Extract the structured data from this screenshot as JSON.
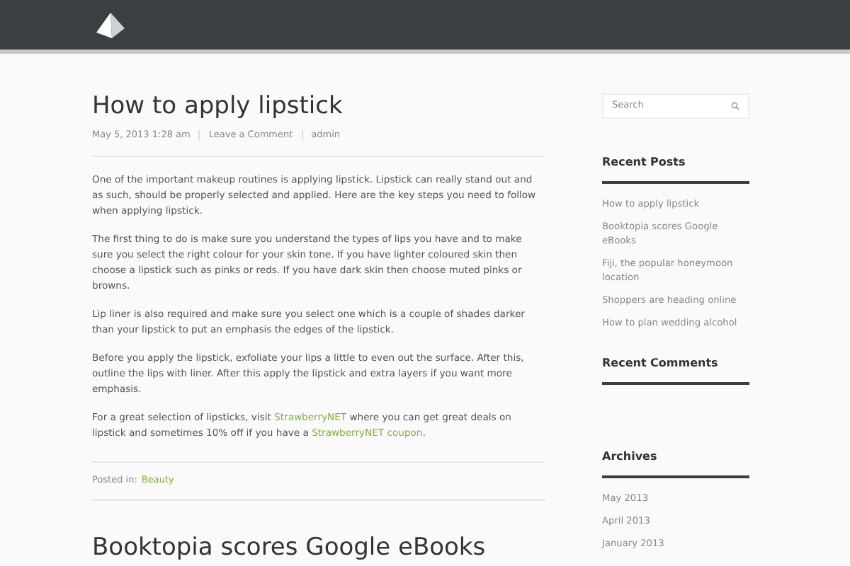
{
  "post": {
    "title": "How to apply lipstick",
    "meta": [
      "May 5, 2013 1:28 am",
      "Leave a Comment",
      "admin"
    ],
    "paragraphs": [
      [
        {
          "kind": "text",
          "text": "One of the important makeup routines is applying lipstick. Lipstick can really stand out and as such, should be properly selected and applied. Here are the key steps you need to follow when applying lipstick."
        }
      ],
      [
        {
          "kind": "text",
          "text": "The first thing to do is make sure you understand the types of lips you have and to make sure you select the right colour for your skin tone.  If you have lighter coloured skin then choose a lipstick such as pinks or reds. If you have dark skin then choose muted pinks or browns."
        }
      ],
      [
        {
          "kind": "text",
          "text": "Lip liner is also required and make sure you select one which is a couple of shades darker than your lipstick to put an emphasis the edges of the lipstick."
        }
      ],
      [
        {
          "kind": "text",
          "text": "Before you apply the lipstick, exfoliate your lips a little to even out the surface. After this, outline the lips with liner. After this apply the lipstick and extra layers if you want more emphasis."
        }
      ],
      [
        {
          "kind": "text",
          "text": "For a great selection of lipsticks, visit "
        },
        {
          "kind": "link",
          "text": "StrawberryNET"
        },
        {
          "kind": "text",
          "text": " where you can get great deals on lipstick and sometimes 10% off if you have a "
        },
        {
          "kind": "link",
          "text": "StrawberryNET coupon"
        },
        {
          "kind": "text",
          "text": "."
        }
      ]
    ],
    "posted_in_label": "Posted in:",
    "category": "Beauty"
  },
  "next_post": {
    "title": "Booktopia scores Google eBooks"
  },
  "sidebar": {
    "search": {
      "placeholder": "Search"
    },
    "widgets": [
      {
        "title": "Recent Posts",
        "items": [
          "How to apply lipstick",
          "Booktopia scores Google eBooks",
          "Fiji, the popular honeymoon location",
          "Shoppers are heading online",
          "How to plan wedding alcohol"
        ]
      },
      {
        "title": "Recent Comments"
      },
      {
        "title": "Archives",
        "items": [
          "May 2013",
          "April 2013",
          "January 2013"
        ]
      }
    ]
  }
}
